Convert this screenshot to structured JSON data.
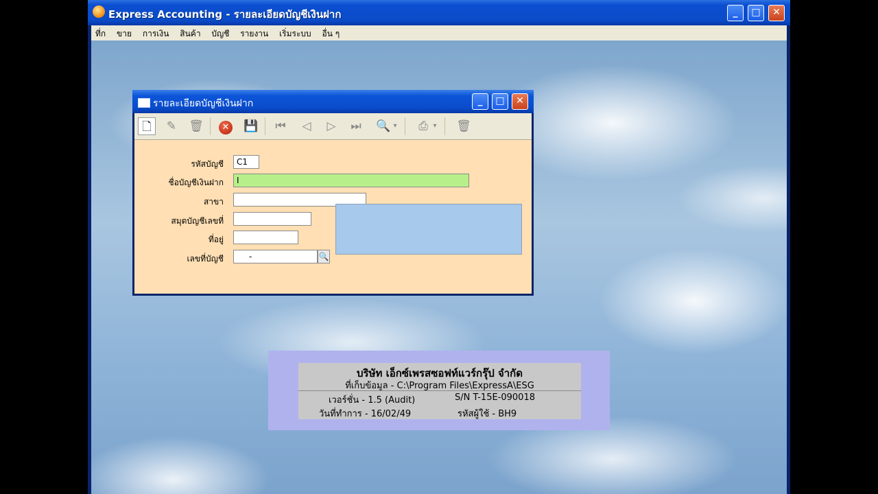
{
  "app": {
    "title": "Express Accounting - รายละเอียดบัญชีเงินฝาก",
    "controls": {
      "minimize": "_",
      "maximize": "□",
      "close": "✕"
    }
  },
  "menu": [
    "ที่ก",
    "ขาย",
    "การเงิน",
    "สินค้า",
    "บัญชี",
    "รายงาน",
    "เริ่มระบบ",
    "อื่น ๆ"
  ],
  "dialog": {
    "title": "รายละเอียดบัญชีเงินฝาก",
    "toolbar": {
      "icons": [
        "new-icon",
        "edit-icon",
        "trash-icon",
        "cancel-icon",
        "save-icon",
        "first-record-icon",
        "prev-record-icon",
        "next-record-icon",
        "last-record-icon",
        "search-icon",
        "print-icon",
        "delete-all-icon"
      ],
      "glyphs": {
        "new": "🗋",
        "edit": "✎",
        "trash": "🗑",
        "cancel": "✕",
        "save": "💾",
        "first": "⏮",
        "prev": "◁",
        "next": "▷",
        "last": "⏭",
        "search": "🔍",
        "print": "⎙",
        "delete_all": "🗑",
        "dropdown": "▾"
      }
    },
    "fields": [
      {
        "label": "รหัสบัญชี",
        "value": "C1"
      },
      {
        "label": "ชื่อบัญชีเงินฝาก",
        "value": "I"
      },
      {
        "label": "สาขา",
        "value": ""
      },
      {
        "label": "สมุดบัญชีเลขที่",
        "value": ""
      },
      {
        "label": "ที่อยู่",
        "value": ""
      },
      {
        "label": "เลขที่บัญชี",
        "value": "-"
      }
    ],
    "lookup_glyph": "🔍"
  },
  "company": {
    "name": "บริษัท เอ็กซ์เพรสซอฟท์แวร์กรุ๊ป จำกัด",
    "path_line": "ที่เก็บข้อมูล - C:\\Program Files\\ExpressA\\ESG",
    "version_line": "เวอร์ชั่น - 1.5 (Audit)",
    "serial_line": "S/N T-15E-090018",
    "date_line": "วันที่ทำการ - 16/02/49",
    "user_line": "รหัสผู้ใช้ - BH9"
  },
  "colors": {
    "form_bg": "#ffdfb3",
    "focus_field": "#b7f08a",
    "titlebar": "#0a4ccc",
    "company_bg": "#b0b2ee"
  }
}
